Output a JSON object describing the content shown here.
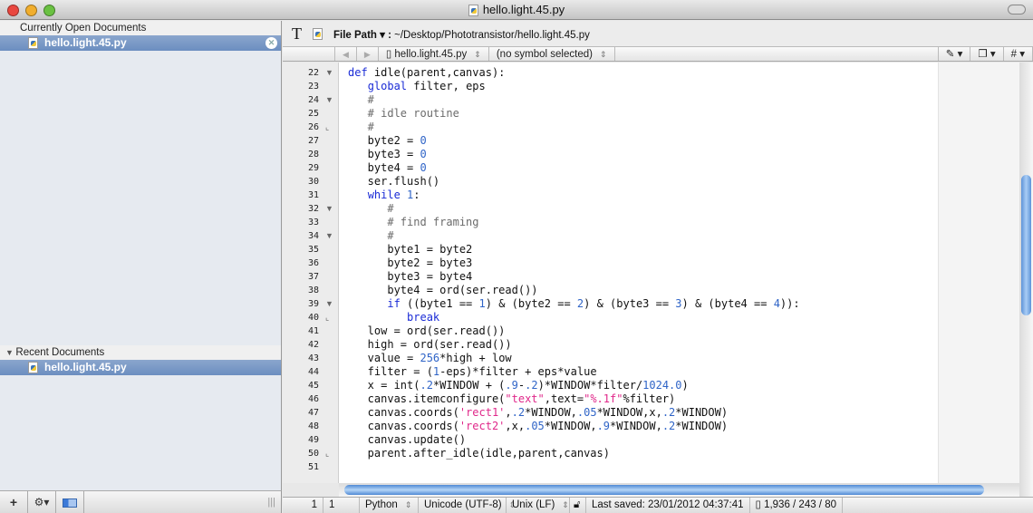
{
  "window": {
    "title": "hello.light.45.py"
  },
  "sidebar": {
    "open_header": "Currently Open Documents",
    "open_docs": [
      "hello.light.45.py"
    ],
    "recent_header": "Recent Documents",
    "recent_docs": [
      "hello.light.45.py"
    ],
    "bottom": {
      "add": "+",
      "gear": "⚙▾"
    }
  },
  "toolbar": {
    "text_tool": "T",
    "file_path_label": "File Path ▾ :",
    "file_path": "~/Desktop/Phototransistor/hello.light.45.py"
  },
  "navbar": {
    "back": "◀",
    "forward": "▶",
    "file": "hello.light.45.py",
    "symbol": "(no symbol selected)",
    "tools": [
      "✎ ▾",
      "❐ ▾",
      "# ▾"
    ]
  },
  "editor": {
    "lines": [
      {
        "n": "22",
        "f": "▼",
        "t": [
          [
            "def",
            "k"
          ],
          [
            " idle(parent,canvas):",
            "p"
          ]
        ]
      },
      {
        "n": "23",
        "f": "",
        "t": [
          [
            "   ",
            "p"
          ],
          [
            "global",
            "k"
          ],
          [
            " filter, eps",
            "p"
          ]
        ]
      },
      {
        "n": "24",
        "f": "▼",
        "t": [
          [
            "   #",
            "c"
          ]
        ]
      },
      {
        "n": "25",
        "f": "",
        "t": [
          [
            "   # idle routine",
            "c"
          ]
        ]
      },
      {
        "n": "26",
        "f": "⌞",
        "t": [
          [
            "   #",
            "c"
          ]
        ]
      },
      {
        "n": "27",
        "f": "",
        "t": [
          [
            "   byte2 = ",
            "p"
          ],
          [
            "0",
            "n"
          ]
        ]
      },
      {
        "n": "28",
        "f": "",
        "t": [
          [
            "   byte3 = ",
            "p"
          ],
          [
            "0",
            "n"
          ]
        ]
      },
      {
        "n": "29",
        "f": "",
        "t": [
          [
            "   byte4 = ",
            "p"
          ],
          [
            "0",
            "n"
          ]
        ]
      },
      {
        "n": "30",
        "f": "",
        "t": [
          [
            "   ser.flush()",
            "p"
          ]
        ]
      },
      {
        "n": "31",
        "f": "",
        "t": [
          [
            "   ",
            "p"
          ],
          [
            "while",
            "k"
          ],
          [
            " ",
            "p"
          ],
          [
            "1",
            "n"
          ],
          [
            ":",
            "p"
          ]
        ]
      },
      {
        "n": "32",
        "f": "▼",
        "t": [
          [
            "      #",
            "c"
          ]
        ]
      },
      {
        "n": "33",
        "f": "",
        "t": [
          [
            "      # find framing",
            "c"
          ]
        ]
      },
      {
        "n": "34",
        "f": "▼",
        "t": [
          [
            "      #",
            "c"
          ]
        ]
      },
      {
        "n": "35",
        "f": "",
        "t": [
          [
            "      byte1 = byte2",
            "p"
          ]
        ]
      },
      {
        "n": "36",
        "f": "",
        "t": [
          [
            "      byte2 = byte3",
            "p"
          ]
        ]
      },
      {
        "n": "37",
        "f": "",
        "t": [
          [
            "      byte3 = byte4",
            "p"
          ]
        ]
      },
      {
        "n": "38",
        "f": "",
        "t": [
          [
            "      byte4 = ord(ser.read())",
            "p"
          ]
        ]
      },
      {
        "n": "39",
        "f": "▼",
        "t": [
          [
            "      ",
            "p"
          ],
          [
            "if",
            "k"
          ],
          [
            " ((byte1 == ",
            "p"
          ],
          [
            "1",
            "n"
          ],
          [
            ") & (byte2 == ",
            "p"
          ],
          [
            "2",
            "n"
          ],
          [
            ") & (byte3 == ",
            "p"
          ],
          [
            "3",
            "n"
          ],
          [
            ") & (byte4 == ",
            "p"
          ],
          [
            "4",
            "n"
          ],
          [
            ")):",
            "p"
          ]
        ]
      },
      {
        "n": "40",
        "f": "⌞",
        "t": [
          [
            "         ",
            "p"
          ],
          [
            "break",
            "k"
          ]
        ]
      },
      {
        "n": "41",
        "f": "",
        "t": [
          [
            "   low = ord(ser.read())",
            "p"
          ]
        ]
      },
      {
        "n": "42",
        "f": "",
        "t": [
          [
            "   high = ord(ser.read())",
            "p"
          ]
        ]
      },
      {
        "n": "43",
        "f": "",
        "t": [
          [
            "   value = ",
            "p"
          ],
          [
            "256",
            "n"
          ],
          [
            "*high + low",
            "p"
          ]
        ]
      },
      {
        "n": "44",
        "f": "",
        "t": [
          [
            "   filter = (",
            "p"
          ],
          [
            "1",
            "n"
          ],
          [
            "-eps)*filter + eps*value",
            "p"
          ]
        ]
      },
      {
        "n": "45",
        "f": "",
        "t": [
          [
            "   x = int(",
            "p"
          ],
          [
            ".2",
            "n"
          ],
          [
            "*WINDOW + (",
            "p"
          ],
          [
            ".9",
            "n"
          ],
          [
            "-",
            "p"
          ],
          [
            ".2",
            "n"
          ],
          [
            ")*WINDOW*filter/",
            "p"
          ],
          [
            "1024.0",
            "n"
          ],
          [
            ")",
            "p"
          ]
        ]
      },
      {
        "n": "46",
        "f": "",
        "t": [
          [
            "   canvas.itemconfigure(",
            "p"
          ],
          [
            "\"text\"",
            "s"
          ],
          [
            ",text=",
            "p"
          ],
          [
            "\"%.1f\"",
            "s"
          ],
          [
            "%filter)",
            "p"
          ]
        ]
      },
      {
        "n": "47",
        "f": "",
        "t": [
          [
            "   canvas.coords(",
            "p"
          ],
          [
            "'rect1'",
            "s"
          ],
          [
            ",",
            "p"
          ],
          [
            ".2",
            "n"
          ],
          [
            "*WINDOW,",
            "p"
          ],
          [
            ".05",
            "n"
          ],
          [
            "*WINDOW,x,",
            "p"
          ],
          [
            ".2",
            "n"
          ],
          [
            "*WINDOW)",
            "p"
          ]
        ]
      },
      {
        "n": "48",
        "f": "",
        "t": [
          [
            "   canvas.coords(",
            "p"
          ],
          [
            "'rect2'",
            "s"
          ],
          [
            ",x,",
            "p"
          ],
          [
            ".05",
            "n"
          ],
          [
            "*WINDOW,",
            "p"
          ],
          [
            ".9",
            "n"
          ],
          [
            "*WINDOW,",
            "p"
          ],
          [
            ".2",
            "n"
          ],
          [
            "*WINDOW)",
            "p"
          ]
        ]
      },
      {
        "n": "49",
        "f": "",
        "t": [
          [
            "   canvas.update()",
            "p"
          ]
        ]
      },
      {
        "n": "50",
        "f": "⌞",
        "t": [
          [
            "   parent.after_idle(idle,parent,canvas)",
            "p"
          ]
        ]
      },
      {
        "n": "51",
        "f": "",
        "t": []
      }
    ]
  },
  "status": {
    "line": "1",
    "col": "1",
    "language": "Python",
    "encoding": "Unicode (UTF-8)",
    "line_endings": "Unix (LF)",
    "saved": "Last saved: 23/01/2012 04:37:41",
    "counts": "1,936 / 243 / 80"
  },
  "colors": {
    "keyword": "#1a2bd6",
    "comment": "#6b6b6b",
    "number": "#2f64c7",
    "string": "#e0288a",
    "selection": "#7596c6"
  }
}
